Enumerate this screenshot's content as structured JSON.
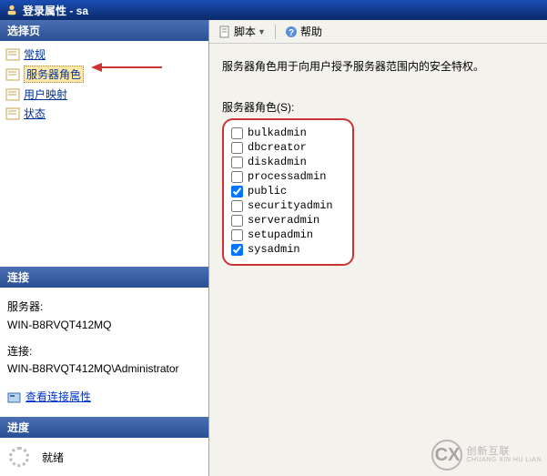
{
  "title": "登录属性 - sa",
  "sidebar": {
    "headers": {
      "select": "选择页",
      "connection": "连接",
      "progress": "进度"
    },
    "nav": [
      {
        "label": "常规",
        "selected": false
      },
      {
        "label": "服务器角色",
        "selected": true
      },
      {
        "label": "用户映射",
        "selected": false
      },
      {
        "label": "状态",
        "selected": false
      }
    ],
    "connection": {
      "server_label": "服务器:",
      "server_value": "WIN-B8RVQT412MQ",
      "conn_label": "连接:",
      "conn_value": "WIN-B8RVQT412MQ\\Administrator",
      "view_link": "查看连接属性"
    },
    "progress": {
      "status": "就绪"
    }
  },
  "toolbar": {
    "script": "脚本",
    "help": "帮助"
  },
  "main": {
    "description": "服务器角色用于向用户授予服务器范围内的安全特权。",
    "roles_label": "服务器角色(S):",
    "roles": [
      {
        "name": "bulkadmin",
        "checked": false
      },
      {
        "name": "dbcreator",
        "checked": false
      },
      {
        "name": "diskadmin",
        "checked": false
      },
      {
        "name": "processadmin",
        "checked": false
      },
      {
        "name": "public",
        "checked": true
      },
      {
        "name": "securityadmin",
        "checked": false
      },
      {
        "name": "serveradmin",
        "checked": false
      },
      {
        "name": "setupadmin",
        "checked": false
      },
      {
        "name": "sysadmin",
        "checked": true
      }
    ]
  },
  "watermark": {
    "cn": "创新互联",
    "en": "CHUANG XIN HU LIAN"
  }
}
